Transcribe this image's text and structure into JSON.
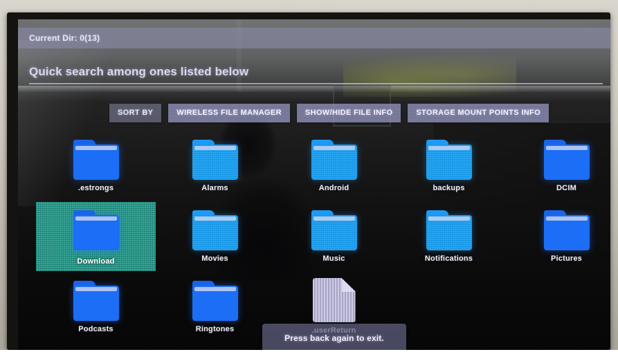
{
  "header": {
    "current_dir_label": "Current Dir: 0(13)",
    "bar_color": "#8a8aa8"
  },
  "search": {
    "hint_text": "Quick search among ones listed below"
  },
  "toolbar": {
    "buttons": [
      {
        "label": "SORT BY",
        "name": "sort-by-button"
      },
      {
        "label": "WIRELESS FILE MANAGER",
        "name": "wireless-file-manager-button"
      },
      {
        "label": "SHOW/HIDE FILE INFO",
        "name": "show-hide-file-info-button"
      },
      {
        "label": "STORAGE MOUNT POINTS INFO",
        "name": "storage-mount-points-info-button"
      }
    ]
  },
  "grid": {
    "selection_color": "#1eaa96",
    "folder_color": "#18a4fb",
    "rows": [
      [
        {
          "label": ".estrongs",
          "type": "folder",
          "tone": "deep",
          "selected": false
        },
        {
          "label": "Alarms",
          "type": "folder",
          "tone": "normal",
          "selected": false
        },
        {
          "label": "Android",
          "type": "folder",
          "tone": "normal",
          "selected": false
        },
        {
          "label": "backups",
          "type": "folder",
          "tone": "normal",
          "selected": false
        },
        {
          "label": "DCIM",
          "type": "folder",
          "tone": "deep",
          "selected": false
        }
      ],
      [
        {
          "label": "Download",
          "type": "folder",
          "tone": "deep",
          "selected": true
        },
        {
          "label": "Movies",
          "type": "folder",
          "tone": "normal",
          "selected": false
        },
        {
          "label": "Music",
          "type": "folder",
          "tone": "normal",
          "selected": false
        },
        {
          "label": "Notifications",
          "type": "folder",
          "tone": "normal",
          "selected": false
        },
        {
          "label": "Pictures",
          "type": "folder",
          "tone": "deep",
          "selected": false
        }
      ],
      [
        {
          "label": "Podcasts",
          "type": "folder",
          "tone": "deep",
          "selected": false
        },
        {
          "label": "Ringtones",
          "type": "folder",
          "tone": "deep",
          "selected": false
        },
        {
          "label": ".userReturn",
          "type": "file",
          "tone": "normal",
          "selected": false
        }
      ]
    ]
  },
  "toast": {
    "message": "Press back again to exit."
  }
}
